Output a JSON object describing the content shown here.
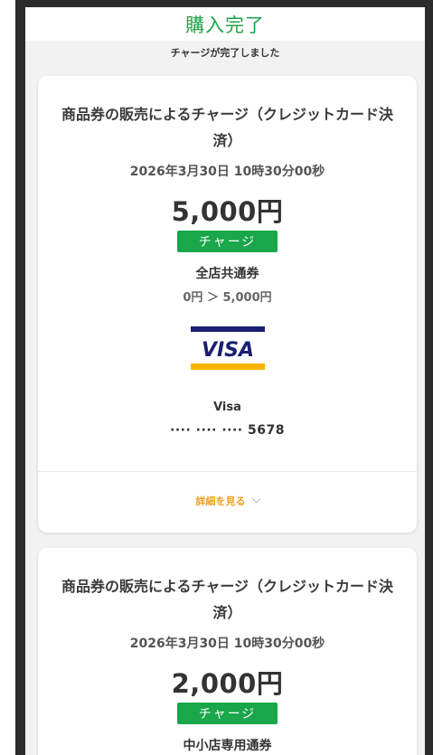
{
  "header": {
    "title": "購入完了"
  },
  "subtitle": "チャージが完了しました",
  "cards": [
    {
      "title": "商品券の販売によるチャージ（クレジットカード決済）",
      "date": "2026年3月30日 10時30分00秒",
      "amount": "5,000円",
      "badge": "チャージ",
      "coupon_name": "全店共通券",
      "balance_change": "0円 ＞ 5,000円",
      "payment_brand_logo": "VISA",
      "payment_brand": "Visa",
      "card_number": "···· ···· ···· 5678",
      "details_label": "詳細を見る"
    },
    {
      "title": "商品券の販売によるチャージ（クレジットカード決済）",
      "date": "2026年3月30日 10時30分00秒",
      "amount": "2,000円",
      "badge": "チャージ",
      "coupon_name": "中小店専用通券"
    }
  ],
  "colors": {
    "accent": "#1aa64a",
    "details": "#f0a020",
    "visa_blue": "#1a1f71",
    "visa_gold": "#f7b600"
  }
}
